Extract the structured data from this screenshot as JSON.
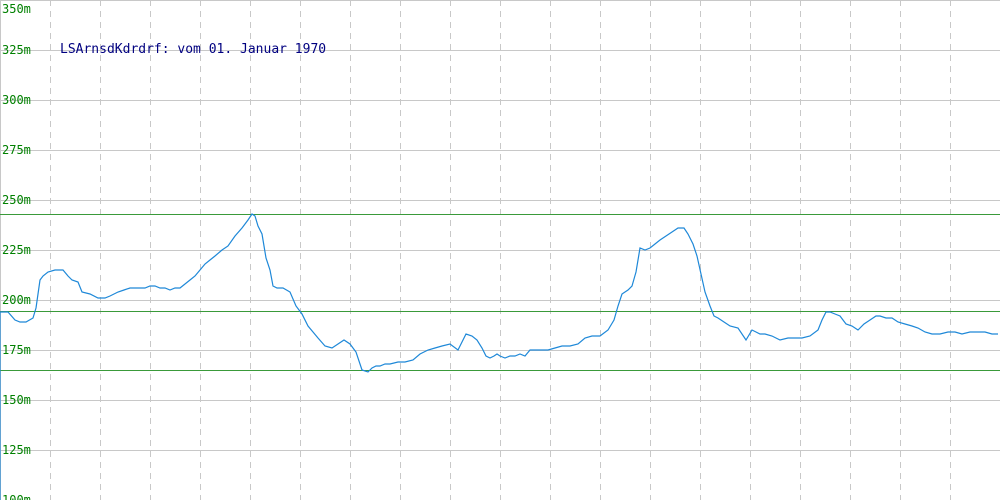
{
  "chart_data": {
    "type": "line",
    "title": "LSArnsdKdrdrf: vom 01. Januar 1970",
    "xlabel": "",
    "ylabel": "",
    "ylim": [
      100,
      350
    ],
    "y_ticks": [
      "100m",
      "125m",
      "150m",
      "175m",
      "200m",
      "225m",
      "250m",
      "275m",
      "300m",
      "325m",
      "350m"
    ],
    "grid": true,
    "reference_lines": [
      243,
      194.5,
      165
    ],
    "colors": {
      "series": "#1e88d8",
      "reference_line": "#3a9a3a",
      "tick_label": "#008000",
      "title": "#000080",
      "grid": "#c8c8c8"
    },
    "series": [
      {
        "x": [
          0,
          8,
          15,
          20,
          26,
          33,
          36,
          40,
          43,
          48,
          55,
          63,
          68,
          72,
          78,
          82,
          90,
          98,
          105,
          110,
          118,
          124,
          130,
          138,
          145,
          150,
          155,
          160,
          165,
          170,
          175,
          180,
          185,
          190,
          195,
          200,
          205,
          210,
          215,
          222,
          228,
          235,
          242,
          248,
          252,
          255,
          258,
          262,
          266,
          270,
          273,
          277,
          283,
          290,
          296,
          302,
          308,
          313,
          318,
          325,
          332,
          338,
          344,
          350,
          356,
          362,
          368,
          372,
          376,
          380,
          385,
          390,
          398,
          405,
          413,
          420,
          428,
          435,
          442,
          450,
          458,
          466,
          472,
          477,
          482,
          486,
          490,
          494,
          497,
          500,
          505,
          510,
          515,
          520,
          525,
          530,
          536,
          542,
          548,
          555,
          562,
          570,
          578,
          585,
          592,
          600,
          608,
          614,
          618,
          622,
          625,
          628,
          632,
          636,
          640,
          645,
          650,
          655,
          660,
          666,
          672,
          678,
          684,
          688,
          693,
          697,
          701,
          705,
          710,
          714,
          718,
          724,
          730,
          738,
          746,
          752,
          756,
          760,
          765,
          772,
          780,
          788,
          795,
          802,
          810,
          818,
          822,
          826,
          830,
          835,
          840,
          846,
          852,
          858,
          864,
          870,
          876,
          880,
          886,
          892,
          898,
          905,
          912,
          918,
          925,
          932,
          940,
          948,
          955,
          962,
          970,
          978,
          985,
          992,
          998
        ],
        "values": [
          194,
          194,
          190,
          189,
          189,
          191,
          196,
          210,
          212,
          214,
          215,
          215,
          212,
          210,
          209,
          204,
          203,
          201,
          201,
          202,
          204,
          205,
          206,
          206,
          206,
          207,
          207,
          206,
          206,
          205,
          206,
          206,
          208,
          210,
          212,
          215,
          218,
          220,
          222,
          225,
          227,
          232,
          236,
          240,
          243,
          242,
          237,
          233,
          221,
          215,
          207,
          206,
          206,
          204,
          197,
          193,
          187,
          184,
          181,
          177,
          176,
          178,
          180,
          178,
          174,
          165,
          164,
          166,
          167,
          167,
          168,
          168,
          169,
          169,
          170,
          173,
          175,
          176,
          177,
          178,
          175,
          183,
          182,
          180,
          176,
          172,
          171,
          172,
          173,
          172,
          171,
          172,
          172,
          173,
          172,
          175,
          175,
          175,
          175,
          176,
          177,
          177,
          178,
          181,
          182,
          182,
          185,
          190,
          197,
          203,
          204,
          205,
          207,
          214,
          226,
          225,
          226,
          228,
          230,
          232,
          234,
          236,
          236,
          233,
          228,
          222,
          213,
          204,
          197,
          192,
          191,
          189,
          187,
          186,
          180,
          185,
          184,
          183,
          183,
          182,
          180,
          181,
          181,
          181,
          182,
          185,
          190,
          194,
          194,
          193,
          192,
          188,
          187,
          185,
          188,
          190,
          192,
          192,
          191,
          191,
          189,
          188,
          187,
          186,
          184,
          183,
          183,
          184,
          184,
          183,
          184,
          184,
          184,
          183,
          183
        ]
      }
    ]
  }
}
